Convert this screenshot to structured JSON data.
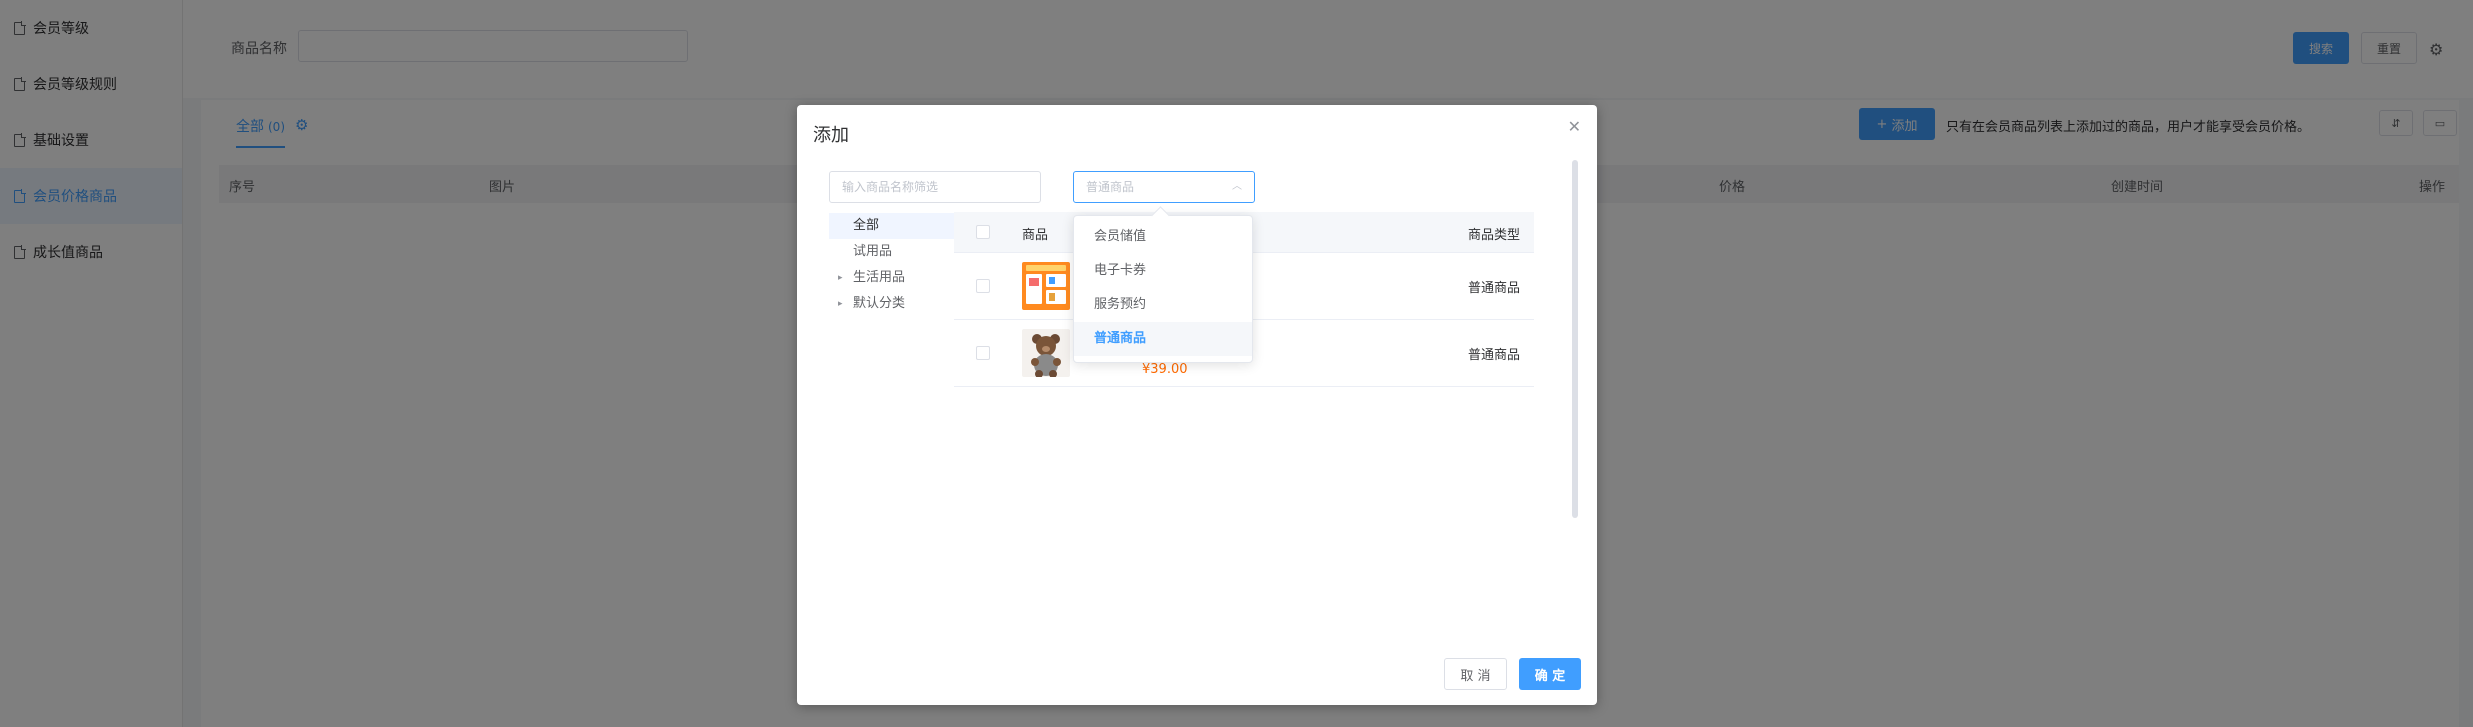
{
  "sidebar": {
    "items": [
      {
        "label": "会员等级"
      },
      {
        "label": "会员等级规则"
      },
      {
        "label": "基础设置"
      },
      {
        "label": "会员价格商品"
      },
      {
        "label": "成长值商品"
      }
    ],
    "active_index": 3
  },
  "search": {
    "label": "商品名称",
    "search_button": "搜索",
    "reset_button": "重置"
  },
  "content": {
    "tab_label": "全部",
    "tab_count": "(0)",
    "add_button": "添加",
    "add_tip": "只有在会员商品列表上添加过的商品，用户才能享受会员价格。",
    "columns": [
      "序号",
      "图片",
      "价格",
      "创建时间",
      "操作"
    ]
  },
  "dialog": {
    "title": "添加",
    "filter_placeholder": "输入商品名称筛选",
    "type_placeholder": "普通商品",
    "tree": [
      {
        "label": "全部",
        "has_children": false
      },
      {
        "label": "试用品",
        "has_children": false
      },
      {
        "label": "生活用品",
        "has_children": true
      },
      {
        "label": "默认分类",
        "has_children": true
      }
    ],
    "table": {
      "col_goods": "商品",
      "col_type": "商品类型",
      "rows": [
        {
          "type": "普通商品",
          "price": ""
        },
        {
          "type": "普通商品",
          "price": "¥39.00"
        }
      ]
    },
    "cancel_button": "取 消",
    "ok_button": "确 定"
  },
  "dropdown": {
    "options": [
      "会员储值",
      "电子卡券",
      "服务预约",
      "普通商品"
    ],
    "selected_index": 3
  },
  "colors": {
    "primary": "#409eff",
    "price": "#ff6a00"
  }
}
